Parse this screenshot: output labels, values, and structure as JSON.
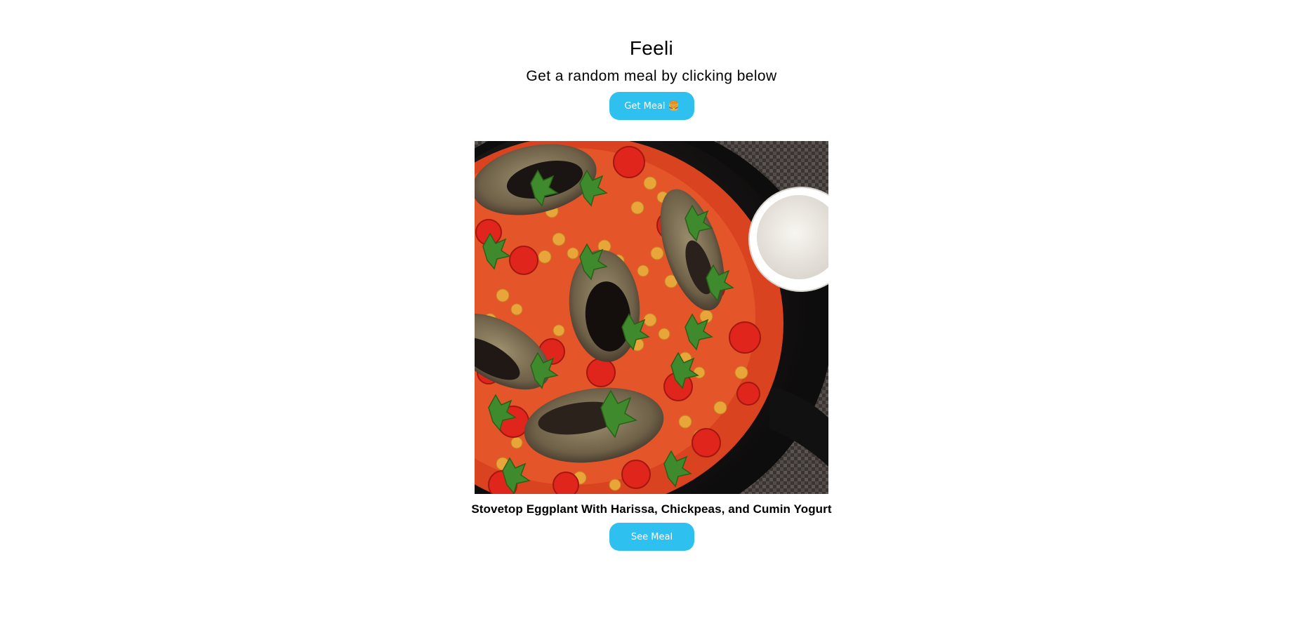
{
  "app": {
    "title": "Feeli",
    "subtitle": "Get a random meal by clicking below"
  },
  "actions": {
    "get_meal_label": "Get Meal",
    "get_meal_icon": "burger-emoji",
    "get_meal_glyph": "🍔",
    "see_meal_label": "See Meal"
  },
  "meal": {
    "name": "Stovetop Eggplant With Harissa, Chickpeas, and Cumin Yogurt",
    "image_alt": "Stovetop Eggplant With Harissa, Chickpeas, and Cumin Yogurt"
  },
  "colors": {
    "accent": "#2ec1ef",
    "button_text": "#ffffff",
    "background": "#ffffff"
  }
}
